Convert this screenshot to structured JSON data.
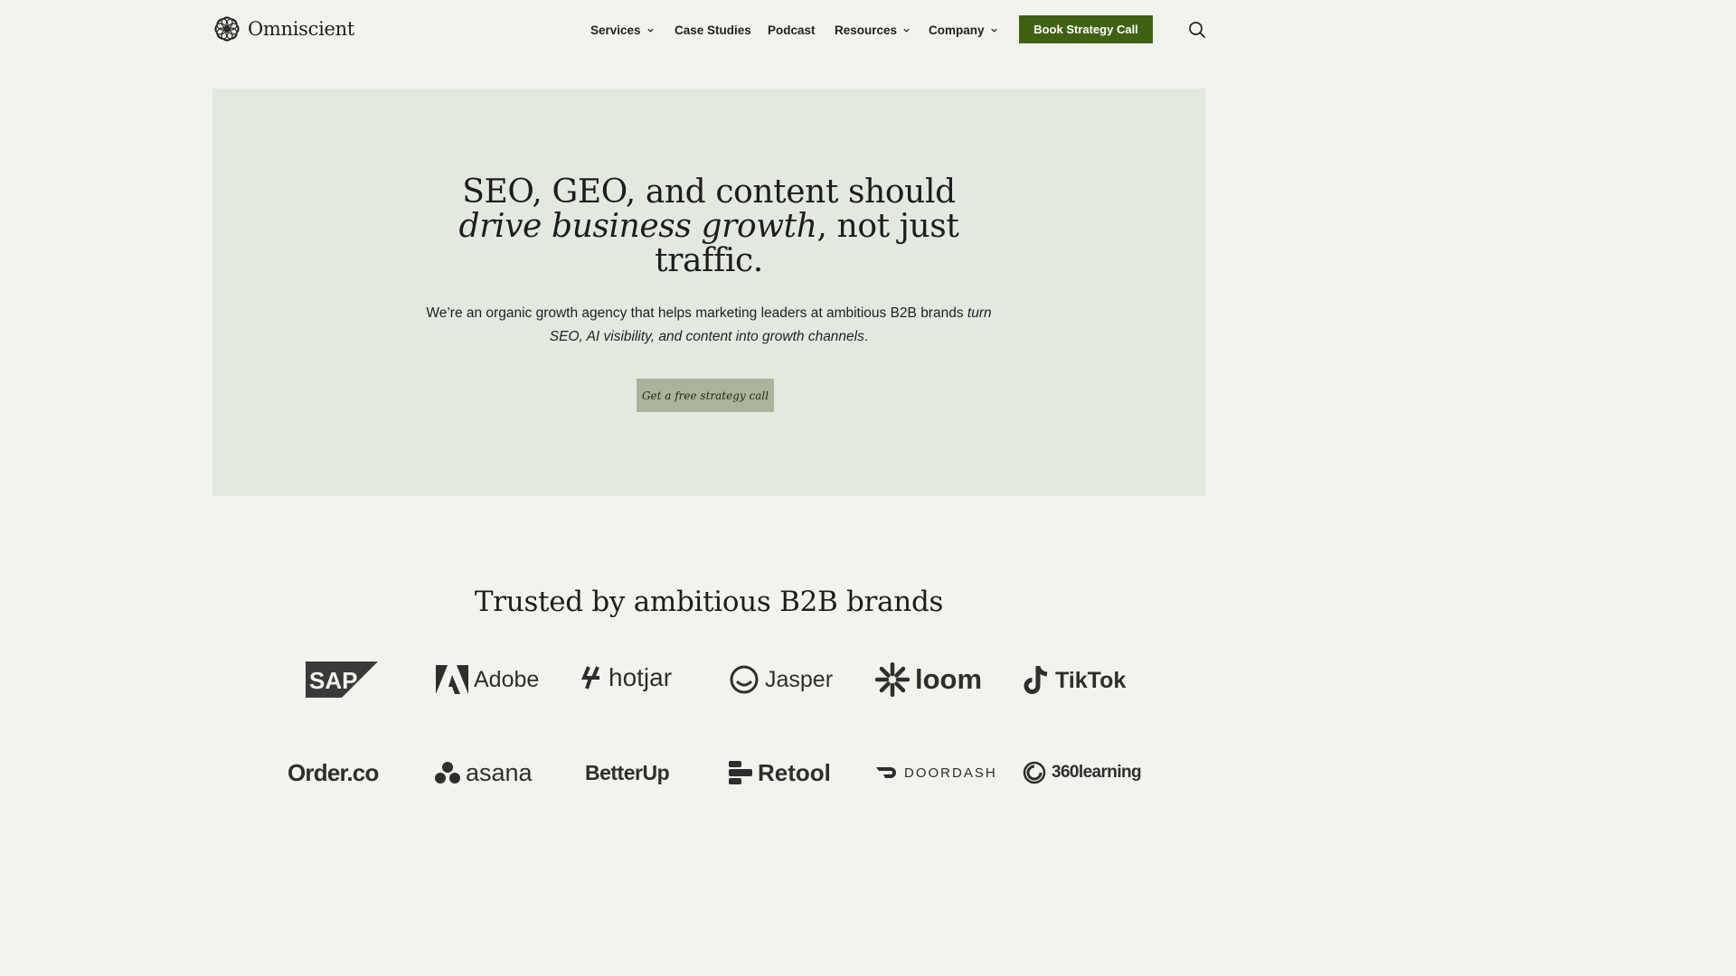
{
  "header": {
    "logo_text": "Omniscient",
    "nav": [
      {
        "label": "Services",
        "has_dropdown": true
      },
      {
        "label": "Case Studies",
        "has_dropdown": false
      },
      {
        "label": "Podcast",
        "has_dropdown": false
      },
      {
        "label": "Resources",
        "has_dropdown": true
      },
      {
        "label": "Company",
        "has_dropdown": true
      }
    ],
    "cta_label": "Book Strategy Call",
    "search_icon": "search-icon"
  },
  "hero": {
    "title_part1": "SEO, GEO, and content should",
    "title_italic": "drive business growth",
    "title_part2": ", not just",
    "title_part3": "traffic.",
    "subtitle_plain": "We’re an organic growth agency that helps marketing leaders at ambitious B2B brands ",
    "subtitle_italic": "turn SEO, AI visibility, and content into growth channels",
    "subtitle_end": ".",
    "cta_label": "Get a free strategy call"
  },
  "trusted": {
    "title": "Trusted by ambitious B2B brands",
    "brands_row1": [
      "SAP",
      "Adobe",
      "hotjar",
      "Jasper",
      "loom",
      "TikTok"
    ],
    "brands_row2": [
      "Order.co",
      "asana",
      "BetterUp",
      "Retool",
      "DOORDASH",
      "360learning"
    ]
  },
  "colors": {
    "page_bg": "#f1f4ed",
    "hero_bg": "#e4e9e0",
    "primary_button": "#3f6114",
    "secondary_button": "#a9b49a"
  }
}
